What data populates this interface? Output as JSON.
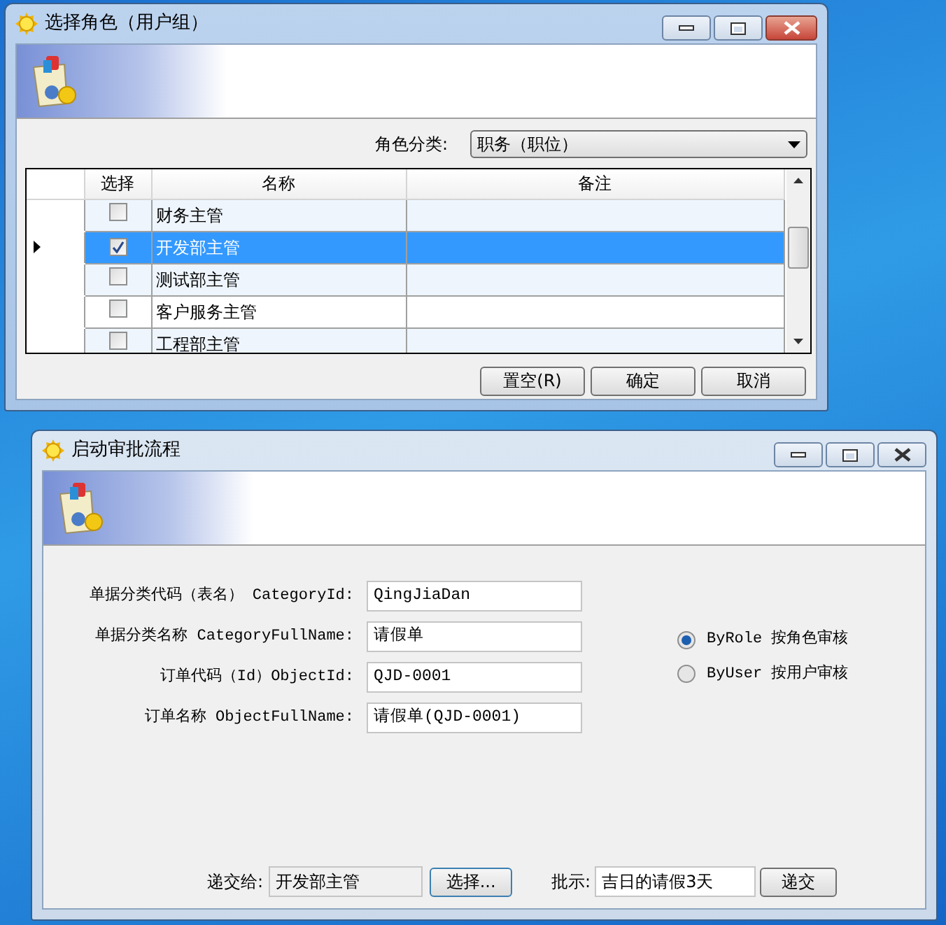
{
  "role_dialog": {
    "title": "选择角色（用户组）",
    "category_label": "角色分类:",
    "category_value": "职务（职位）",
    "columns": [
      "选择",
      "名称",
      "备注"
    ],
    "rows": [
      {
        "name": "财务主管",
        "checked": false,
        "selected": false
      },
      {
        "name": "开发部主管",
        "checked": true,
        "selected": true
      },
      {
        "name": "测试部主管",
        "checked": false,
        "selected": false
      },
      {
        "name": "客户服务主管",
        "checked": false,
        "selected": false
      },
      {
        "name": "工程部主管",
        "checked": false,
        "selected": false
      }
    ],
    "buttons": [
      "置空(R)",
      "确定",
      "取消"
    ]
  },
  "approval_dialog": {
    "title": "启动审批流程",
    "fields": [
      {
        "label": "单据分类代码（表名） CategoryId:",
        "value": "QingJiaDan"
      },
      {
        "label": "单据分类名称 CategoryFullName:",
        "value": "请假单"
      },
      {
        "label": "订单代码（Id）ObjectId:",
        "value": "QJD-0001"
      },
      {
        "label": "订单名称 ObjectFullName:",
        "value": "请假单(QJD-0001)"
      }
    ],
    "radios": [
      {
        "label": "ByRole 按角色审核",
        "selected": true
      },
      {
        "label": "ByUser 按用户审核",
        "selected": false
      }
    ],
    "submit_to_label": "递交给:",
    "submit_to_value": "开发部主管",
    "select_button": "选择...",
    "comment_label": "批示:",
    "comment_value": "吉日的请假3天",
    "submit_button": "递交"
  }
}
